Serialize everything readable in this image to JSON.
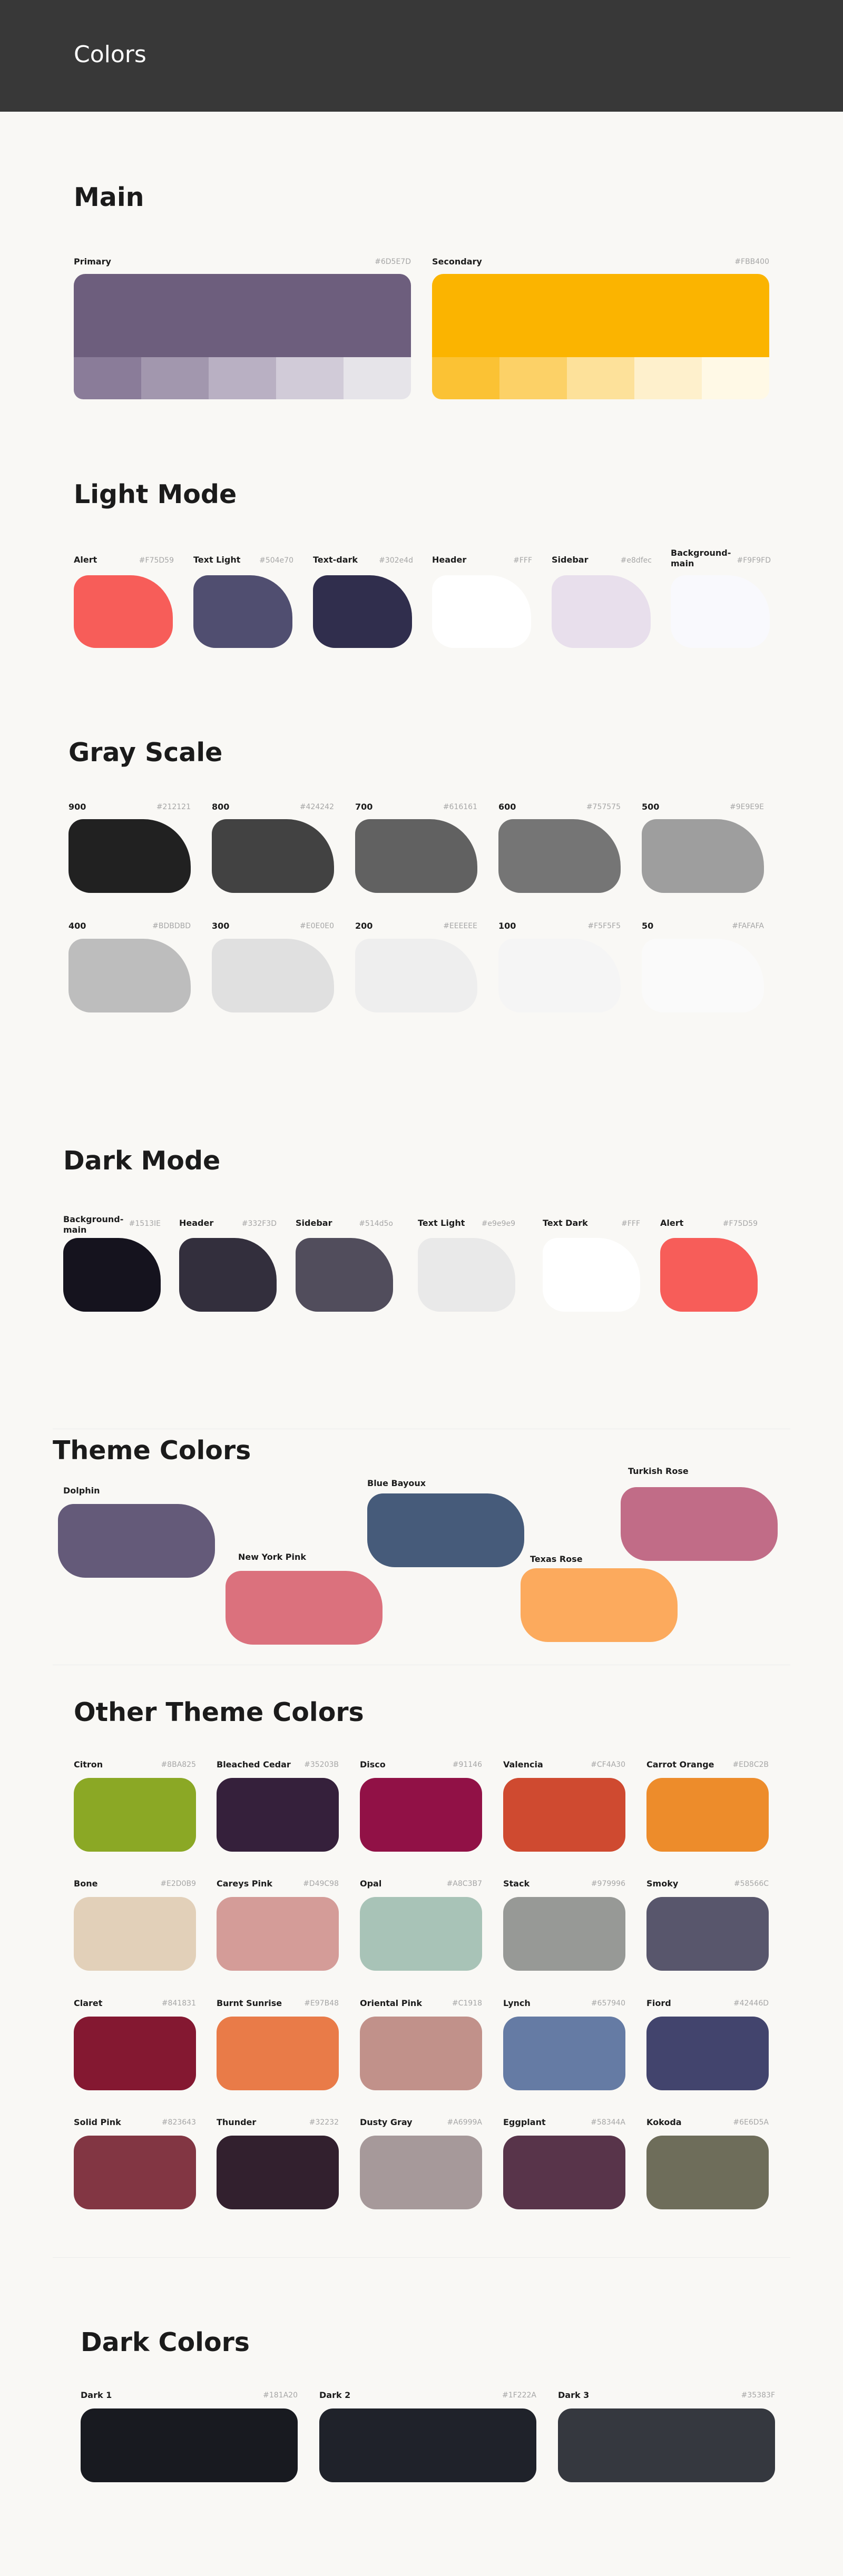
{
  "header": {
    "title": "Colors"
  },
  "main": {
    "title": "Main",
    "primary": {
      "label": "Primary",
      "hex": "#6D5E7D",
      "color": "#6d5e7d",
      "tints": [
        "#8a7c99",
        "#a297ae",
        "#b9b0c3",
        "#d1cbd8",
        "#e6e4e9"
      ]
    },
    "secondary": {
      "label": "Secondary",
      "hex": "#FBB400",
      "color": "#fbb400",
      "tints": [
        "#fbc234",
        "#fcd167",
        "#fde19a",
        "#fef0cc",
        "#fff9e6"
      ]
    }
  },
  "light_mode": {
    "title": "Light Mode",
    "items": [
      {
        "label": "Alert",
        "hex": "#F75D59",
        "color": "#f75d59"
      },
      {
        "label": "Text Light",
        "hex": "#504e70",
        "color": "#504e70"
      },
      {
        "label": "Text-dark",
        "hex": "#302e4d",
        "color": "#302e4d"
      },
      {
        "label": "Header",
        "hex": "#FFF",
        "color": "#ffffff"
      },
      {
        "label": "Sidebar",
        "hex": "#e8dfec",
        "color": "#e8dfec"
      },
      {
        "label": "Background-main",
        "hex": "#F9F9FD",
        "color": "#f9f9fd"
      }
    ]
  },
  "gray_scale": {
    "title": "Gray Scale",
    "row1": [
      {
        "label": "900",
        "hex": "#212121",
        "color": "#212121"
      },
      {
        "label": "800",
        "hex": "#424242",
        "color": "#424242"
      },
      {
        "label": "700",
        "hex": "#616161",
        "color": "#616161"
      },
      {
        "label": "600",
        "hex": "#757575",
        "color": "#757575"
      },
      {
        "label": "500",
        "hex": "#9E9E9E",
        "color": "#9e9e9e"
      }
    ],
    "row2": [
      {
        "label": "400",
        "hex": "#BDBDBD",
        "color": "#bdbdbd"
      },
      {
        "label": "300",
        "hex": "#E0E0E0",
        "color": "#e0e0e0"
      },
      {
        "label": "200",
        "hex": "#EEEEEE",
        "color": "#eeeeee"
      },
      {
        "label": "100",
        "hex": "#F5F5F5",
        "color": "#f5f5f5"
      },
      {
        "label": "50",
        "hex": "#FAFAFA",
        "color": "#fafafa"
      }
    ]
  },
  "dark_mode": {
    "title": "Dark Mode",
    "items": [
      {
        "label": "Background-main",
        "hex": "#1513IE",
        "color": "#15131e"
      },
      {
        "label": "Header",
        "hex": "#332F3D",
        "color": "#332f3d"
      },
      {
        "label": "Sidebar",
        "hex": "#514d5o",
        "color": "#514d5c"
      },
      {
        "label": "Text Light",
        "hex": "#e9e9e9",
        "color": "#e9e9e9"
      },
      {
        "label": "Text Dark",
        "hex": "#FFF",
        "color": "#ffffff"
      },
      {
        "label": "Alert",
        "hex": "#F75D59",
        "color": "#f75d59"
      }
    ]
  },
  "theme_colors": {
    "title": "Theme Colors",
    "items": [
      {
        "label": "Dolphin",
        "color": "#645a79"
      },
      {
        "label": "New York Pink",
        "color": "#db717d"
      },
      {
        "label": "Blue Bayoux",
        "color": "#465b7a"
      },
      {
        "label": "Texas Rose",
        "color": "#fcaa5d"
      },
      {
        "label": "Turkish Rose",
        "color": "#c16c87"
      }
    ]
  },
  "other_theme": {
    "title": "Other Theme Colors",
    "rows": [
      [
        {
          "label": "Citron",
          "hex": "#8BA825",
          "color": "#8ba825"
        },
        {
          "label": "Bleached Cedar",
          "hex": "#35203B",
          "color": "#35203b"
        },
        {
          "label": "Disco",
          "hex": "#91146",
          "color": "#911146"
        },
        {
          "label": "Valencia",
          "hex": "#CF4A30",
          "color": "#cf4a30"
        },
        {
          "label": "Carrot Orange",
          "hex": "#ED8C2B",
          "color": "#ed8c2b"
        }
      ],
      [
        {
          "label": "Bone",
          "hex": "#E2D0B9",
          "color": "#e2d0b9"
        },
        {
          "label": "Careys Pink",
          "hex": "#D49C98",
          "color": "#d49c98"
        },
        {
          "label": "Opal",
          "hex": "#A8C3B7",
          "color": "#a8c3b7"
        },
        {
          "label": "Stack",
          "hex": "#979996",
          "color": "#979996"
        },
        {
          "label": "Smoky",
          "hex": "#58566C",
          "color": "#58566c"
        }
      ],
      [
        {
          "label": "Claret",
          "hex": "#841831",
          "color": "#841831"
        },
        {
          "label": "Burnt Sunrise",
          "hex": "#E97B48",
          "color": "#e97b48"
        },
        {
          "label": "Oriental Pink",
          "hex": "#C1918",
          "color": "#c1918a"
        },
        {
          "label": "Lynch",
          "hex": "#657940",
          "color": "#657ba4"
        },
        {
          "label": "Fiord",
          "hex": "#42446D",
          "color": "#42446d"
        }
      ],
      [
        {
          "label": "Solid Pink",
          "hex": "#823643",
          "color": "#823643"
        },
        {
          "label": "Thunder",
          "hex": "#32232",
          "color": "#32202e"
        },
        {
          "label": "Dusty Gray",
          "hex": "#A6999A",
          "color": "#a6999a"
        },
        {
          "label": "Eggplant",
          "hex": "#58344A",
          "color": "#58344a"
        },
        {
          "label": "Kokoda",
          "hex": "#6E6D5A",
          "color": "#6e6d5a"
        }
      ]
    ]
  },
  "dark_colors": {
    "title": "Dark Colors",
    "items": [
      {
        "label": "Dark 1",
        "hex": "#181A20",
        "color": "#181a20"
      },
      {
        "label": "Dark 2",
        "hex": "#1F222A",
        "color": "#1f222a"
      },
      {
        "label": "Dark 3",
        "hex": "#35383F",
        "color": "#35383f"
      }
    ]
  }
}
